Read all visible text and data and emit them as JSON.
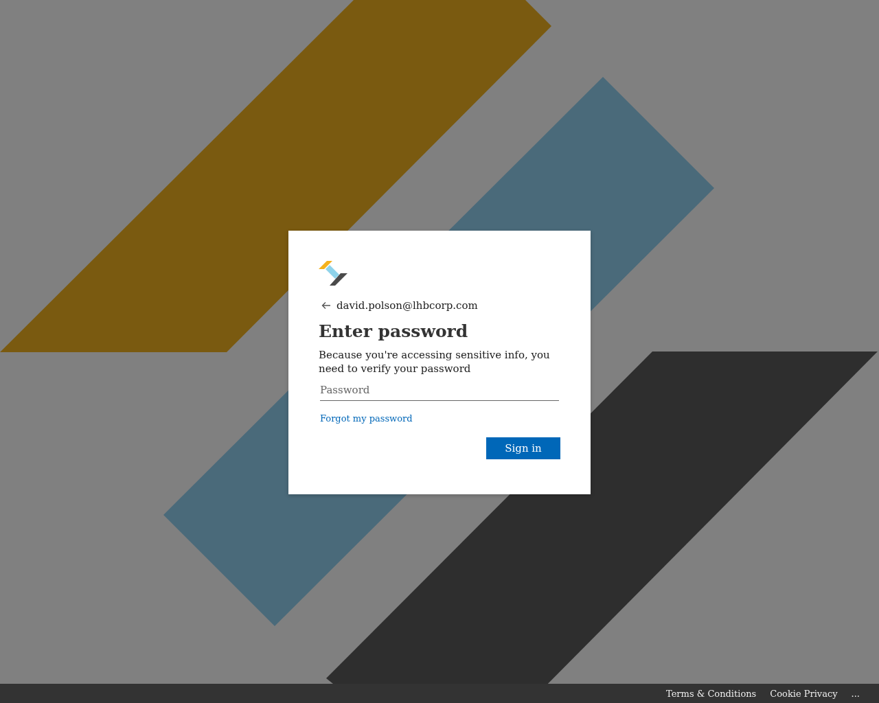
{
  "card": {
    "identity": "david.polson@lhbcorp.com",
    "title": "Enter password",
    "description": "Because you're accessing sensitive info, you need to verify your password",
    "password": {
      "placeholder": "Password"
    },
    "forgot_link": "Forgot my password",
    "submit": "Sign in"
  },
  "footer": {
    "links": [
      "Terms & Conditions",
      "Cookie Privacy",
      "..."
    ]
  }
}
